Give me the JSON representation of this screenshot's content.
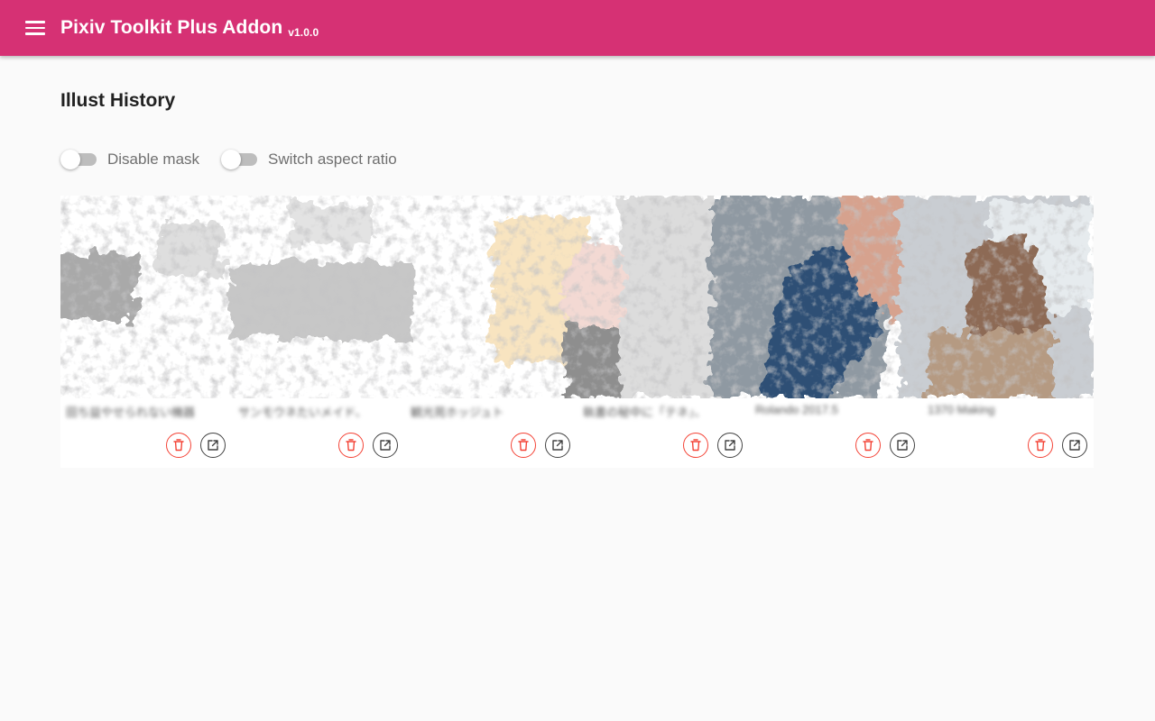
{
  "app": {
    "title": "Pixiv Toolkit Plus Addon",
    "version": "v1.0.0",
    "brand_color": "#d63174"
  },
  "page": {
    "title": "Illust History"
  },
  "toggles": [
    {
      "label": "Disable mask",
      "checked": false
    },
    {
      "label": "Switch aspect ratio",
      "checked": false
    }
  ],
  "illusts": [
    {
      "title": "田ち益やせられない機器"
    },
    {
      "title": "サンモウネたいメイド、"
    },
    {
      "title": "観光苑ホッジュト"
    },
    {
      "title": "執書の秘中に「テネ」、"
    },
    {
      "title": "Rolando 2017.5"
    },
    {
      "title": "1370 Making"
    }
  ],
  "icons": {
    "menu": "menu-icon",
    "delete": "trash-icon",
    "open": "open-in-new-icon"
  },
  "colors": {
    "delete": "#f44336",
    "open": "#424242",
    "toggle_track": "#bdbdbd"
  }
}
